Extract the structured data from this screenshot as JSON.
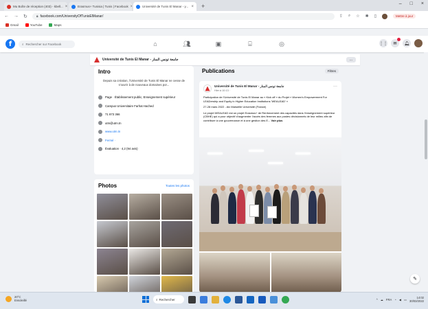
{
  "browser": {
    "tabs": [
      {
        "title": "Mu Boîte de réception (403) - kbell...",
        "icon_color": "#d93025"
      },
      {
        "title": "Erasmus+ Tunisia | Tunis | Facebook",
        "icon_color": "#1877f2"
      },
      {
        "title": "Université de Tunis El Manar - y...",
        "icon_color": "#1877f2"
      }
    ],
    "url": "facebook.com/UniversityOfTunisElManar/",
    "error_label": "Mettre à jour",
    "bookmarks": [
      {
        "label": "Gmail",
        "color": "#d93025"
      },
      {
        "label": "YouTube",
        "color": "#ff0000"
      },
      {
        "label": "Maps",
        "color": "#34a853"
      }
    ]
  },
  "facebook": {
    "search_placeholder": "Rechercher sur Facebook",
    "nav_icons": [
      "home-icon",
      "friends-icon",
      "watch-icon",
      "marketplace-icon",
      "groups-icon"
    ],
    "brand_color": "#1877f2"
  },
  "page": {
    "name": "Université de Tunis El Manar - جامعة تونس المنار",
    "more": "..."
  },
  "intro": {
    "title": "Intro",
    "description": "Depuis sa création, l'Université de Tunis El Manar ne cesse de s'ouvrir à de nouveaux domaines por...",
    "rows": [
      {
        "icon": "info-icon",
        "text": "Page · Établissement public, Enseignement supérieur",
        "link": false
      },
      {
        "icon": "location-icon",
        "text": "Campus Universitaire Farhat Hached",
        "link": false
      },
      {
        "icon": "phone-icon",
        "text": "71 873 366",
        "link": false
      },
      {
        "icon": "email-icon",
        "text": "utm@utm.tn",
        "link": false
      },
      {
        "icon": "website-icon",
        "text": "www.utm.tn",
        "link": true
      },
      {
        "icon": "rating-icon",
        "text": "Fermé ·",
        "link": true
      },
      {
        "icon": "star-icon",
        "text": "Évaluation · 4,2 (94 avis)",
        "link": false
      }
    ]
  },
  "photos": {
    "title": "Photos",
    "see_all": "Toutes les photos",
    "tiles": [
      "#8f8e99",
      "#b7aea2",
      "#9a8f84",
      "#c5c8cf",
      "#a7a39e",
      "#6e6a73",
      "#8c8491",
      "#e9e7e4",
      "#b3a894",
      "#d7c9ae",
      "#cfd3da",
      "#e0b84a"
    ]
  },
  "publications": {
    "title": "Publications",
    "filter": "Filtres",
    "post": {
      "author": "Université de Tunis El Manar - جامعة تونس المنار",
      "date": "Hier à 10:13 ·",
      "text": [
        "Participation de l'Université de Tunis El Manar au « Kick off » du Projet « Women's Empowerment For LEADership and Equity in Higher Education Institutions 'WEALEAD' »",
        "27-28 mars 2022 - Aix Marseille Université (France)",
        "Le projet WEALEAD est un projet Erasmus+ de Renforcement des capacités dans l'enseignement supérieur (CBHE) qui a pour objectif d'augmenter l'accès des femmes aux postes décisionnels de leur milieu afin de contribuer à une gouvernance et à une gestion des E..."
      ],
      "see_more": "Voir plus"
    }
  },
  "taskbar": {
    "weather_temp": "20°C",
    "weather_desc": "Ensoleillé",
    "search_label": "Rechercher",
    "lang": "FRA",
    "time": "14:02",
    "date": "30/03/2022"
  }
}
